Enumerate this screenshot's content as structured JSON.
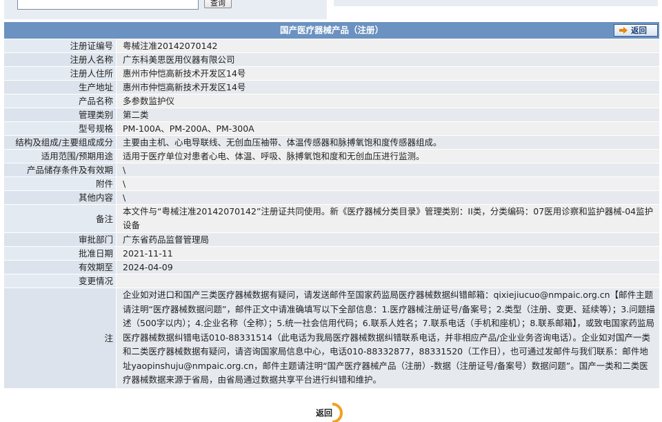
{
  "search": {
    "value": "",
    "button_label": "查询"
  },
  "header": {
    "title": "国产医疗器械产品（注册）",
    "back_label": "返回"
  },
  "fields": [
    {
      "label": "注册证编号",
      "value": "粤械注准20142070142"
    },
    {
      "label": "注册人名称",
      "value": "广东科美思医用仪器有限公司"
    },
    {
      "label": "注册人住所",
      "value": "惠州市仲恺高新技术开发区14号"
    },
    {
      "label": "生产地址",
      "value": "惠州市仲恺高新技术开发区14号"
    },
    {
      "label": "产品名称",
      "value": "多参数监护仪"
    },
    {
      "label": "管理类别",
      "value": "第二类"
    },
    {
      "label": "型号规格",
      "value": "PM-100A、PM-200A、PM-300A"
    },
    {
      "label": "结构及组成/主要组成成分",
      "value": "主要由主机、心电导联线、无创血压袖带、体温传感器和脉搏氧饱和度传感器组成。"
    },
    {
      "label": "适用范围/预期用途",
      "value": "适用于医疗单位对患者心电、体温、呼吸、脉搏氧饱和度和无创血压进行监测。"
    },
    {
      "label": "产品储存条件及有效期",
      "value": "\\"
    },
    {
      "label": "附件",
      "value": "\\"
    },
    {
      "label": "其他内容",
      "value": "\\"
    },
    {
      "label": "备注",
      "value": "本文件与“粤械注准20142070142”注册证共同使用。新《医疗器械分类目录》管理类别：II类，分类编码：07医用诊察和监护器械-04监护设备"
    },
    {
      "label": "审批部门",
      "value": "广东省药品监督管理局"
    },
    {
      "label": "批准日期",
      "value": "2021-11-11"
    },
    {
      "label": "有效期至",
      "value": "2024-04-09"
    },
    {
      "label": "变更情况",
      "value": ""
    },
    {
      "label": "注",
      "value": "企业如对进口和国产三类医疗器械数据有疑问，请发送邮件至国家药监局医疗器械数据纠错邮箱：qixiejiucuo@nmpaic.org.cn【邮件主题请注明“医疗器械数据问题”，邮件正文中请准确填写以下全部信息：1.医疗器械注册证号/备案号；2.类型（注册、变更、延续等）；3.问题描述（500字以内）；4.企业名称（全称）；5.统一社会信用代码；6.联系人姓名；7.联系电话（手机和座机）；8.联系邮箱】，或致电国家药监局医疗器械数据纠错电话010-88331514（此电话为我局医疗器械数据纠错联系电话，并非相应产品/企业业务咨询电话）。企业如对国产一类和二类医疗器械数据有疑问，请咨询国家局信息中心，电话010-88332877，88331520（工作日），也可通过发邮件与我们联系：邮件地址yaopinshuju@nmpaic.org.cn，邮件主题请注明“国产医疗器械产品（注册）-数据（注册证号/备案号）数据问题”。国产一类和二类医疗器械数据来源于省局，由省局通过数据共享平台进行纠错和维护。"
    }
  ],
  "footer": {
    "back_label": "返回"
  },
  "colors": {
    "title_bar": "#6b92c0",
    "label_bg": "#e4eaf2",
    "value_bg": "#f0f0f0",
    "back_orange": "#f0a020"
  }
}
